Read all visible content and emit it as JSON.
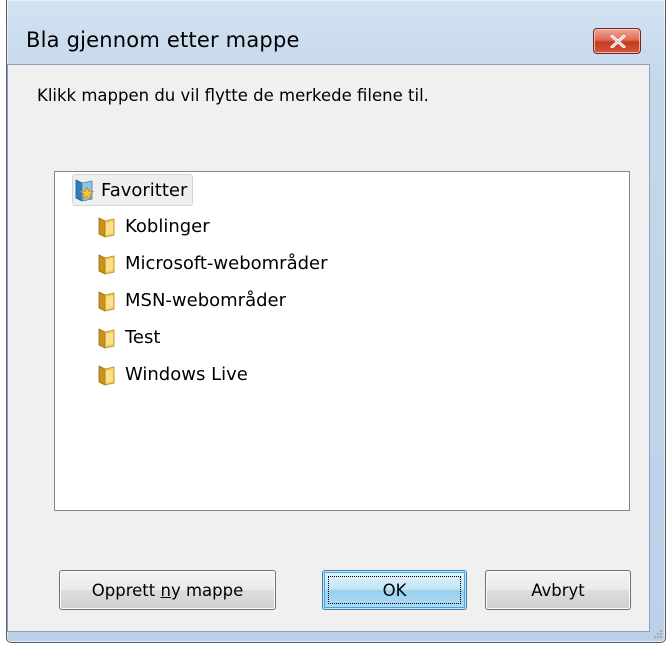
{
  "window": {
    "title": "Bla gjennom etter mappe"
  },
  "dialog": {
    "instruction": "Klikk mappen du vil flytte de merkede filene til."
  },
  "tree": {
    "root": {
      "label": "Favoritter",
      "icon": "favorites-folder-icon",
      "selected": true
    },
    "children": [
      {
        "label": "Koblinger",
        "icon": "folder-icon"
      },
      {
        "label": "Microsoft-webområder",
        "icon": "folder-icon"
      },
      {
        "label": "MSN-webområder",
        "icon": "folder-icon"
      },
      {
        "label": "Test",
        "icon": "folder-icon"
      },
      {
        "label": "Windows Live",
        "icon": "folder-icon"
      }
    ]
  },
  "buttons": {
    "new_folder_pre": "Opprett ",
    "new_folder_mnemonic": "n",
    "new_folder_post": "y mappe",
    "ok": "OK",
    "cancel": "Avbryt"
  },
  "colors": {
    "title_bar": "#c4d7eb",
    "close_button": "#c63a20",
    "client_background": "#f0f0f0",
    "default_button": "#98d1ef",
    "folder": "#e8b828"
  }
}
